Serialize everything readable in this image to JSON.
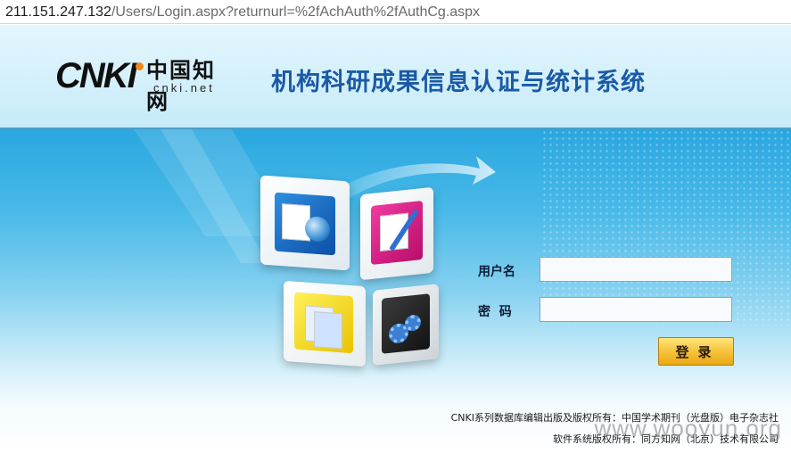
{
  "browser": {
    "url_host": "211.151.247.132",
    "url_path": "/Users/Login.aspx?returnurl=%2fAchAuth%2fAuthCg.aspx"
  },
  "header": {
    "logo_latin": "CNKI",
    "logo_chinese": "中国知网",
    "logo_domain": "cnki.net",
    "system_title": "机构科研成果信息认证与统计系统"
  },
  "login_form": {
    "username_label": "用户名",
    "username_value": "",
    "password_label": "密  码",
    "password_value": "",
    "submit_label": "登录"
  },
  "footer": {
    "copyright_line1": "CNKI系列数据库编辑出版及版权所有：中国学术期刊（光盘版）电子杂志社",
    "copyright_line2": "软件系统版权所有：同方知网（北京）技术有限公司"
  },
  "watermark": "www.wooyun.org",
  "colors": {
    "title_blue": "#1b5aa6",
    "button_gold": "#f7c33c",
    "banner_blue": "#2aa7e0"
  }
}
